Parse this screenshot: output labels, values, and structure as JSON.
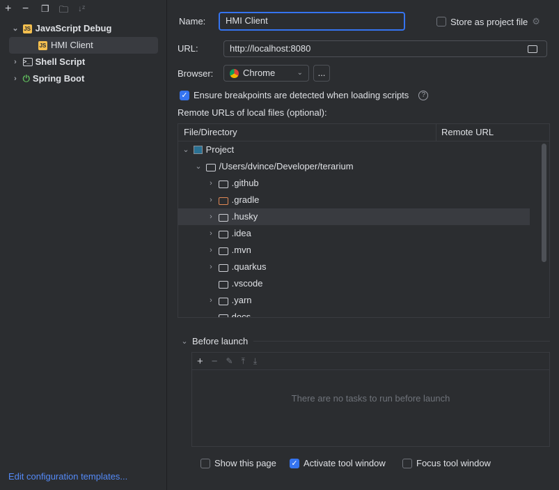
{
  "toolbar": {
    "icons": [
      "plus-icon",
      "minus-icon",
      "copy-icon",
      "new-folder-icon",
      "sort-icon"
    ]
  },
  "sidebar": {
    "items": [
      {
        "label": "JavaScript Debug",
        "expanded": true
      },
      {
        "label": "HMI Client",
        "selected": true
      },
      {
        "label": "Shell Script"
      },
      {
        "label": "Spring Boot"
      }
    ],
    "footer_link": "Edit configuration templates..."
  },
  "form": {
    "name_label": "Name:",
    "name_value": "HMI Client",
    "store_label": "Store as project file",
    "store_checked": false,
    "url_label": "URL:",
    "url_value": "http://localhost:8080",
    "browser_label": "Browser:",
    "browser_value": "Chrome",
    "more_label": "...",
    "ensure_label": "Ensure breakpoints are detected when loading scripts",
    "ensure_checked": true,
    "remote_label": "Remote URLs of local files (optional):"
  },
  "table": {
    "col1": "File/Directory",
    "col2": "Remote URL",
    "root": "Project",
    "path": "/Users/dvince/Developer/terarium",
    "folders": [
      ".github",
      ".gradle",
      ".husky",
      ".idea",
      ".mvn",
      ".quarkus",
      ".vscode",
      ".yarn",
      "docs"
    ]
  },
  "before_launch": {
    "title": "Before launch",
    "empty": "There are no tasks to run before launch"
  },
  "bottom": {
    "show_page": "Show this page",
    "show_page_checked": false,
    "activate": "Activate tool window",
    "activate_checked": true,
    "focus": "Focus tool window",
    "focus_checked": false
  },
  "colors": {
    "accent": "#3574f0",
    "link": "#548af7",
    "gradle": "#e08855",
    "selection": "#393b40"
  }
}
